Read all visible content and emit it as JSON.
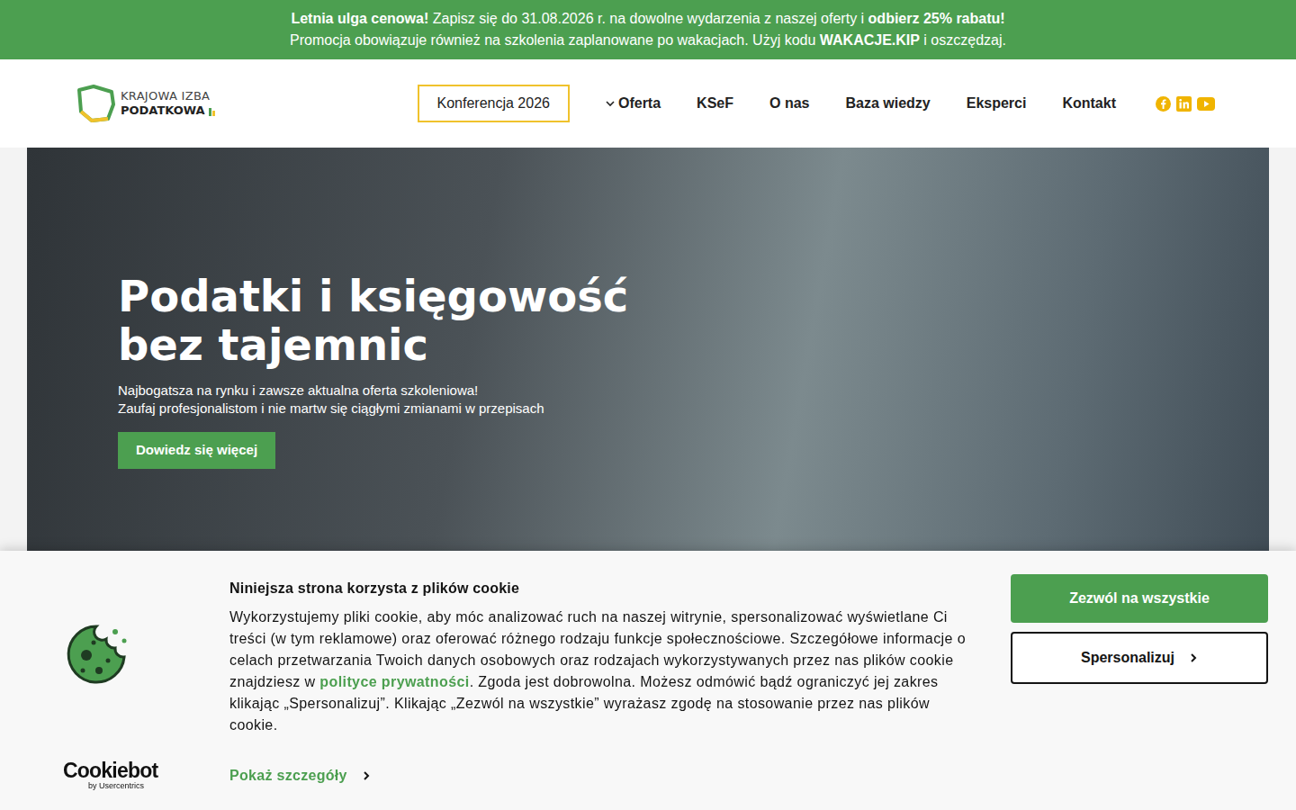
{
  "promo": {
    "lines": [
      [
        {
          "text": "Letnia ulga cenowa!",
          "bold": true
        },
        {
          "text": " Zapisz się do 31.08.2026 r. na dowolne wydarzenia z naszej oferty i ",
          "bold": false
        },
        {
          "text": "odbierz 25% rabatu!",
          "bold": true
        }
      ],
      [
        {
          "text": "Promocja obowiązuje również na szkolenia zaplanowane po wakacjach. Użyj kodu ",
          "bold": false
        },
        {
          "text": "WAKACJE.KIP",
          "bold": true
        },
        {
          "text": " i oszczędzaj.",
          "bold": false
        }
      ]
    ]
  },
  "logo": {
    "line1": "KRAJOWA IZBA",
    "line2": "PODATKOWA"
  },
  "nav": [
    {
      "label": "Konferencja 2026",
      "kind": "boxed"
    },
    {
      "label": "Oferta",
      "kind": "dropdown"
    },
    {
      "label": "KSeF",
      "kind": "link"
    },
    {
      "label": "O nas",
      "kind": "link"
    },
    {
      "label": "Baza wiedzy",
      "kind": "link"
    },
    {
      "label": "Eksperci",
      "kind": "link"
    },
    {
      "label": "Kontakt",
      "kind": "link"
    }
  ],
  "hero": {
    "title": [
      "Podatki i księgowość",
      "bez tajemnic"
    ],
    "subtitle": [
      "Najbogatsza na rynku i zawsze aktualna oferta szkoleniowa!",
      "Zaufaj profesjonalistom i nie martw się ciągłymi zmianami w przepisach"
    ],
    "button": "Dowiedz się więcej"
  },
  "cookie": {
    "title": "Niniejsza strona korzysta z plików cookie",
    "body": [
      {
        "text": "Wykorzystujemy pliki cookie, aby móc analizować ruch na naszej witrynie, spersonalizować wyświetlane Ci treści (w tym reklamowe) oraz oferować różnego rodzaju funkcje społecznościowe. Szczegółowe informacje o celach przetwarzania Twoich danych osobowych oraz rodzajach wykorzystywanych przez nas plików cookie znajdziesz w ",
        "kind": "text"
      },
      {
        "text": "polityce prywatności",
        "kind": "link"
      },
      {
        "text": ". Zgoda jest dobrowolna. Możesz odmówić bądź ograniczyć jej zakres klikając „Spersonalizuj”. Klikając „Zezwól na wszystkie” wyrażasz zgodę na stosowanie przez nas plików cookie.",
        "kind": "text"
      }
    ],
    "details": "Pokaż szczegóły",
    "allow": "Zezwól na wszystkie",
    "customize": "Spersonalizuj",
    "brand": "Cookiebot",
    "brand_sub": "by Usercentrics"
  }
}
